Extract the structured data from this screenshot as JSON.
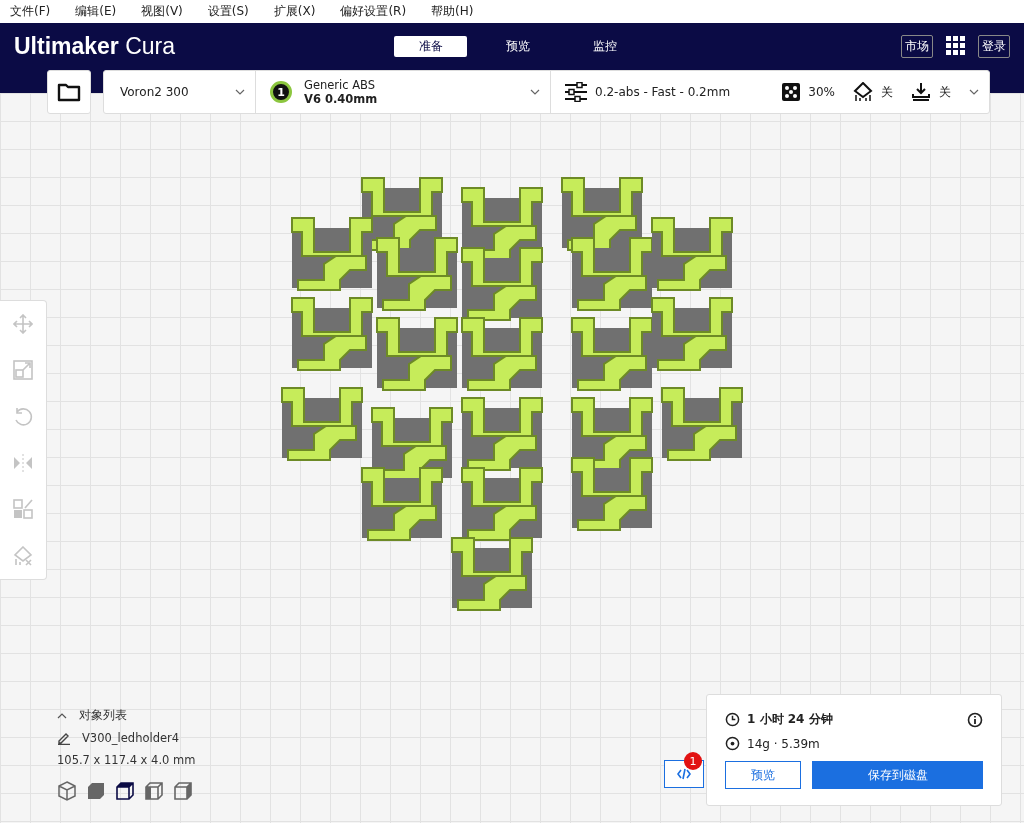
{
  "menu": [
    {
      "label": "文件(F)"
    },
    {
      "label": "编辑(E)"
    },
    {
      "label": "视图(V)"
    },
    {
      "label": "设置(S)"
    },
    {
      "label": "扩展(X)"
    },
    {
      "label": "偏好设置(R)"
    },
    {
      "label": "帮助(H)"
    }
  ],
  "app_title": {
    "brand": "Ultimaker",
    "product": "Cura"
  },
  "stages": [
    {
      "label": "准备",
      "selected": true
    },
    {
      "label": "预览",
      "selected": false
    },
    {
      "label": "监控",
      "selected": false
    }
  ],
  "header_buttons": {
    "marketplace": "市场",
    "login": "登录"
  },
  "toolbar": {
    "printer": "Voron2 300",
    "extruder": {
      "number": "1",
      "material": "Generic ABS",
      "nozzle": "V6 0.40mm"
    },
    "print_settings": {
      "profile": "0.2-abs - Fast - 0.2mm",
      "infill": "30%",
      "support": "关",
      "adhesion": "关"
    }
  },
  "object_list": {
    "header": "对象列表",
    "expanded": true,
    "name": "V300_ledholder4",
    "dimensions": "105.7 x 117.4 x 4.0 mm"
  },
  "view_buttons": [
    {
      "kind": "iso",
      "selected": false
    },
    {
      "kind": "front",
      "selected": false
    },
    {
      "kind": "top",
      "selected": true
    },
    {
      "kind": "left",
      "selected": false
    },
    {
      "kind": "right",
      "selected": false
    }
  ],
  "messages": {
    "badge": "1"
  },
  "print_panel": {
    "time": "1 小时 24 分钟",
    "material": "14g · 5.39m",
    "preview_button": "预览",
    "save_button": "保存到磁盘"
  }
}
